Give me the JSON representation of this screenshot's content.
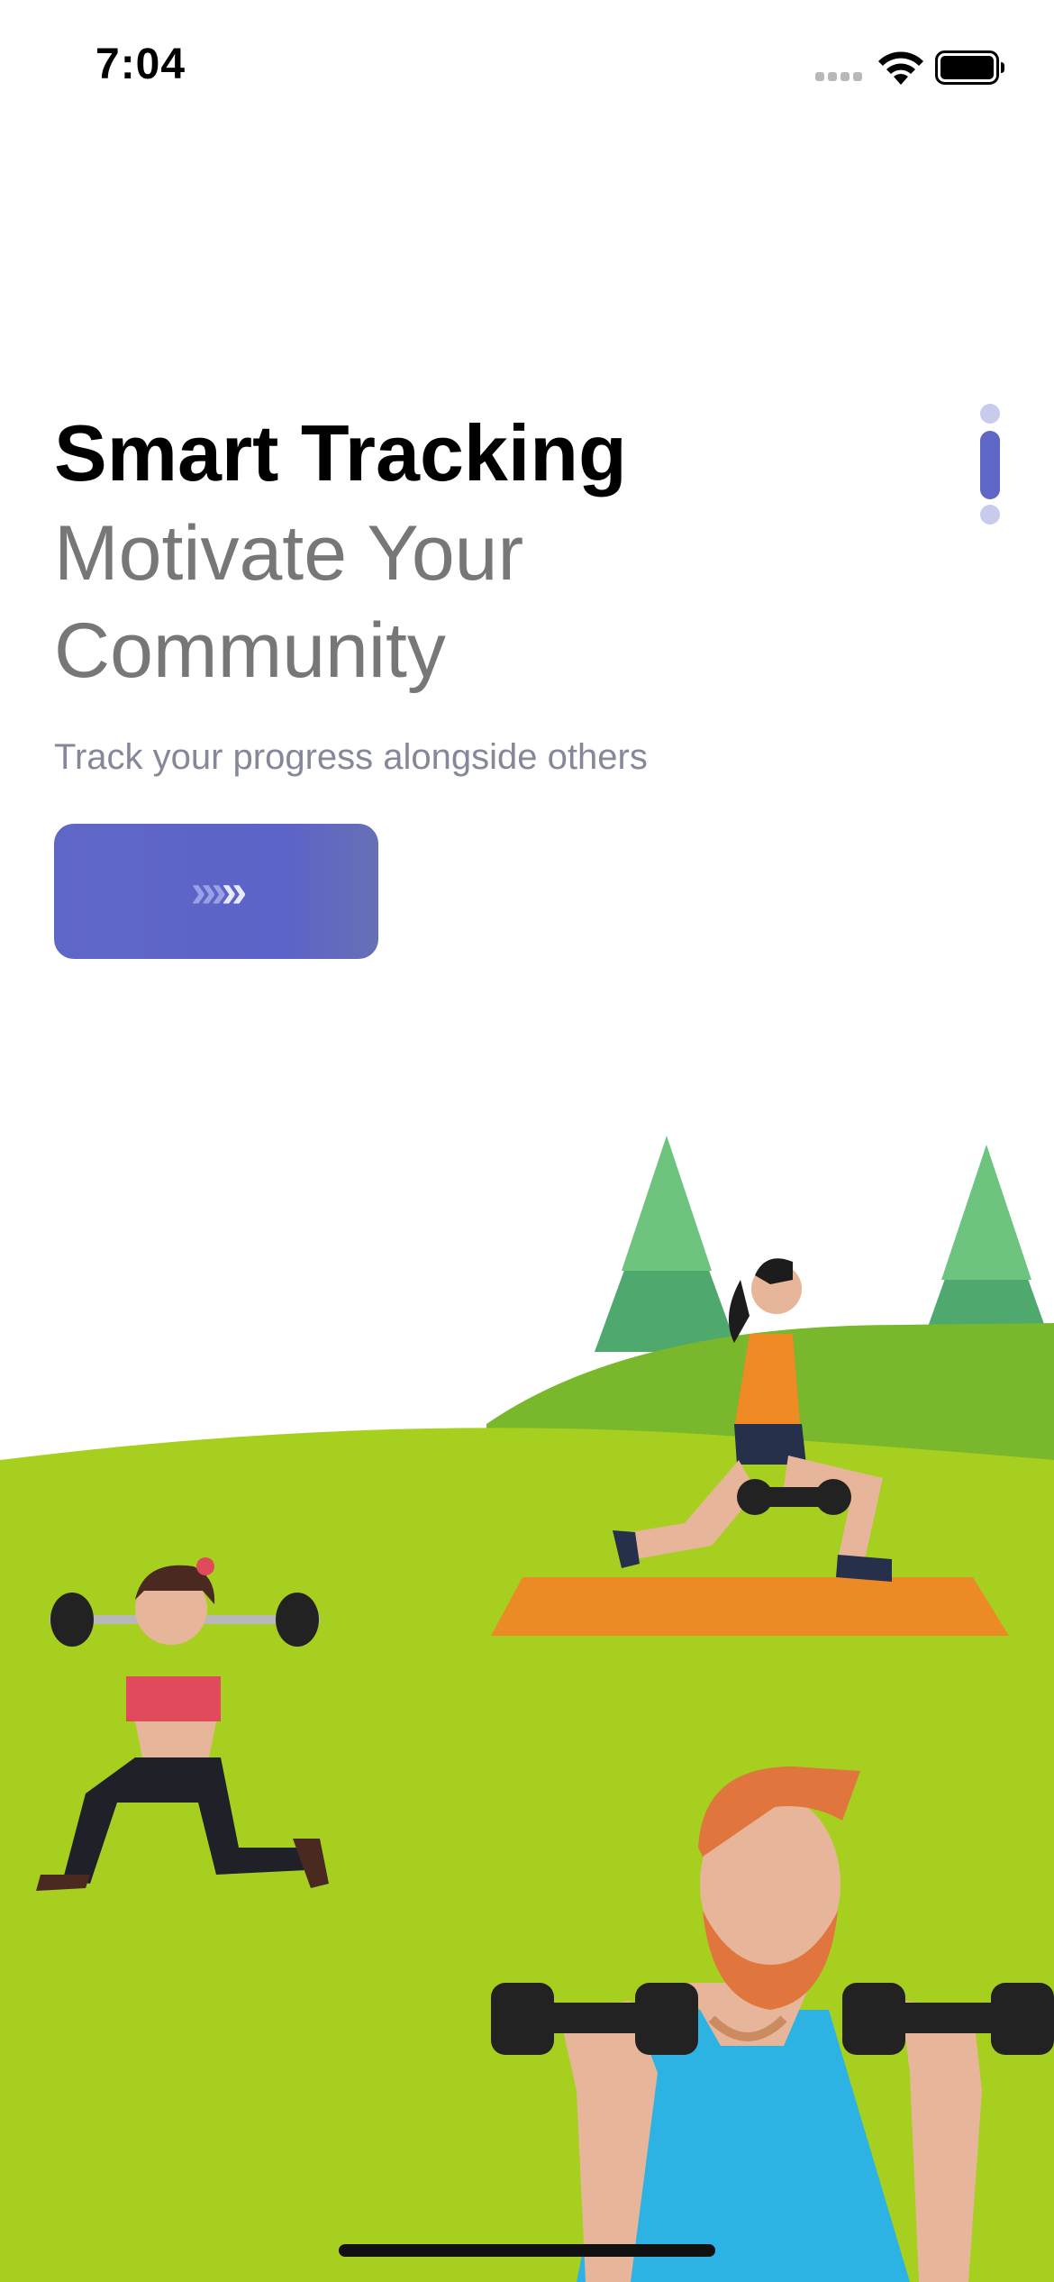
{
  "status_bar": {
    "time": "7:04",
    "icons": [
      "cellular-signal-icon",
      "wifi-icon",
      "battery-icon"
    ]
  },
  "onboarding": {
    "title": "Smart Tracking",
    "subtitle": "Motivate Your Community",
    "description": "Track your progress alongside others",
    "next_button_icon": "chevrons-right-icon",
    "page_indicator": {
      "total": 3,
      "active_index": 1
    }
  },
  "colors": {
    "accent": "#5f67c6",
    "title": "#000000",
    "subtitle": "#777777",
    "description": "#85879a",
    "grass": "#a7cf20",
    "hill": "#79b72c"
  },
  "illustration": {
    "icon": "fitness-people-illustration"
  }
}
